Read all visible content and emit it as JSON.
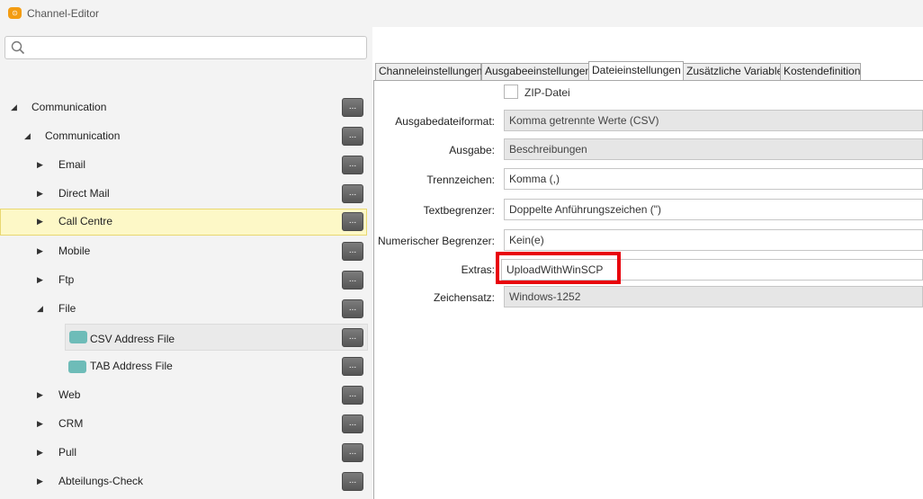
{
  "window": {
    "title": "Channel-Editor",
    "icon": "app-logo-icon",
    "accent": "#f39c12"
  },
  "search": {
    "placeholder": "",
    "value": ""
  },
  "tree": {
    "dots_label": "...",
    "items": [
      {
        "label": "Communication",
        "expanded": true,
        "icon": "collapse-arrow-icon"
      },
      {
        "label": "Communication",
        "expanded": true,
        "icon": "collapse-arrow-icon"
      },
      {
        "label": "Email",
        "expanded": false,
        "icon": "expand-arrow-icon"
      },
      {
        "label": "Direct Mail",
        "expanded": false,
        "icon": "expand-arrow-icon"
      },
      {
        "label": "Call Centre",
        "expanded": false,
        "selected": true,
        "icon": "expand-arrow-icon"
      },
      {
        "label": "Mobile",
        "expanded": false,
        "icon": "expand-arrow-icon"
      },
      {
        "label": "Ftp",
        "expanded": false,
        "icon": "expand-arrow-icon"
      },
      {
        "label": "File",
        "expanded": true,
        "icon": "collapse-arrow-icon"
      },
      {
        "label": "CSV Address File",
        "icon": "file-channel-icon"
      },
      {
        "label": "TAB Address File",
        "icon": "file-channel-icon"
      },
      {
        "label": "Web",
        "expanded": false,
        "icon": "expand-arrow-icon"
      },
      {
        "label": "CRM",
        "expanded": false,
        "icon": "expand-arrow-icon"
      },
      {
        "label": "Pull",
        "expanded": false,
        "icon": "expand-arrow-icon"
      },
      {
        "label": "Abteilungs-Check",
        "expanded": false,
        "icon": "expand-arrow-icon"
      }
    ],
    "selected_color": "#fdf8c7",
    "file_icon_color": "#6ebcb8"
  },
  "tabs": [
    {
      "label": "Channeleinstellungen",
      "active": false
    },
    {
      "label": "Ausgabeeinstellungen",
      "active": false
    },
    {
      "label": "Dateieinstellungen",
      "active": true
    },
    {
      "label": "Zusätzliche Variable",
      "active": false
    },
    {
      "label": "Kostendefinition",
      "active": false
    }
  ],
  "file_settings": {
    "zip_label": "ZIP-Datei",
    "zip_checked": false,
    "fields": [
      {
        "label": "Ausgabedateiformat:",
        "value": "Komma getrennte Werte (CSV)",
        "kind": "dropdown"
      },
      {
        "label": "Ausgabe:",
        "value": "Beschreibungen",
        "kind": "dropdown"
      },
      {
        "label": "Trennzeichen:",
        "value": "Komma (,)",
        "kind": "textbox"
      },
      {
        "label": "Textbegrenzer:",
        "value": "Doppelte Anführungszeichen (\")",
        "kind": "textbox"
      },
      {
        "label": "Numerischer Begrenzer:",
        "value": "Kein(e)",
        "kind": "textbox"
      },
      {
        "label": "Extras:",
        "value": "UploadWithWinSCP",
        "kind": "textbox",
        "highlighted": true
      },
      {
        "label": "Zeichensatz:",
        "value": "Windows-1252",
        "kind": "dropdown"
      }
    ],
    "highlight_color": "#e8000b"
  }
}
